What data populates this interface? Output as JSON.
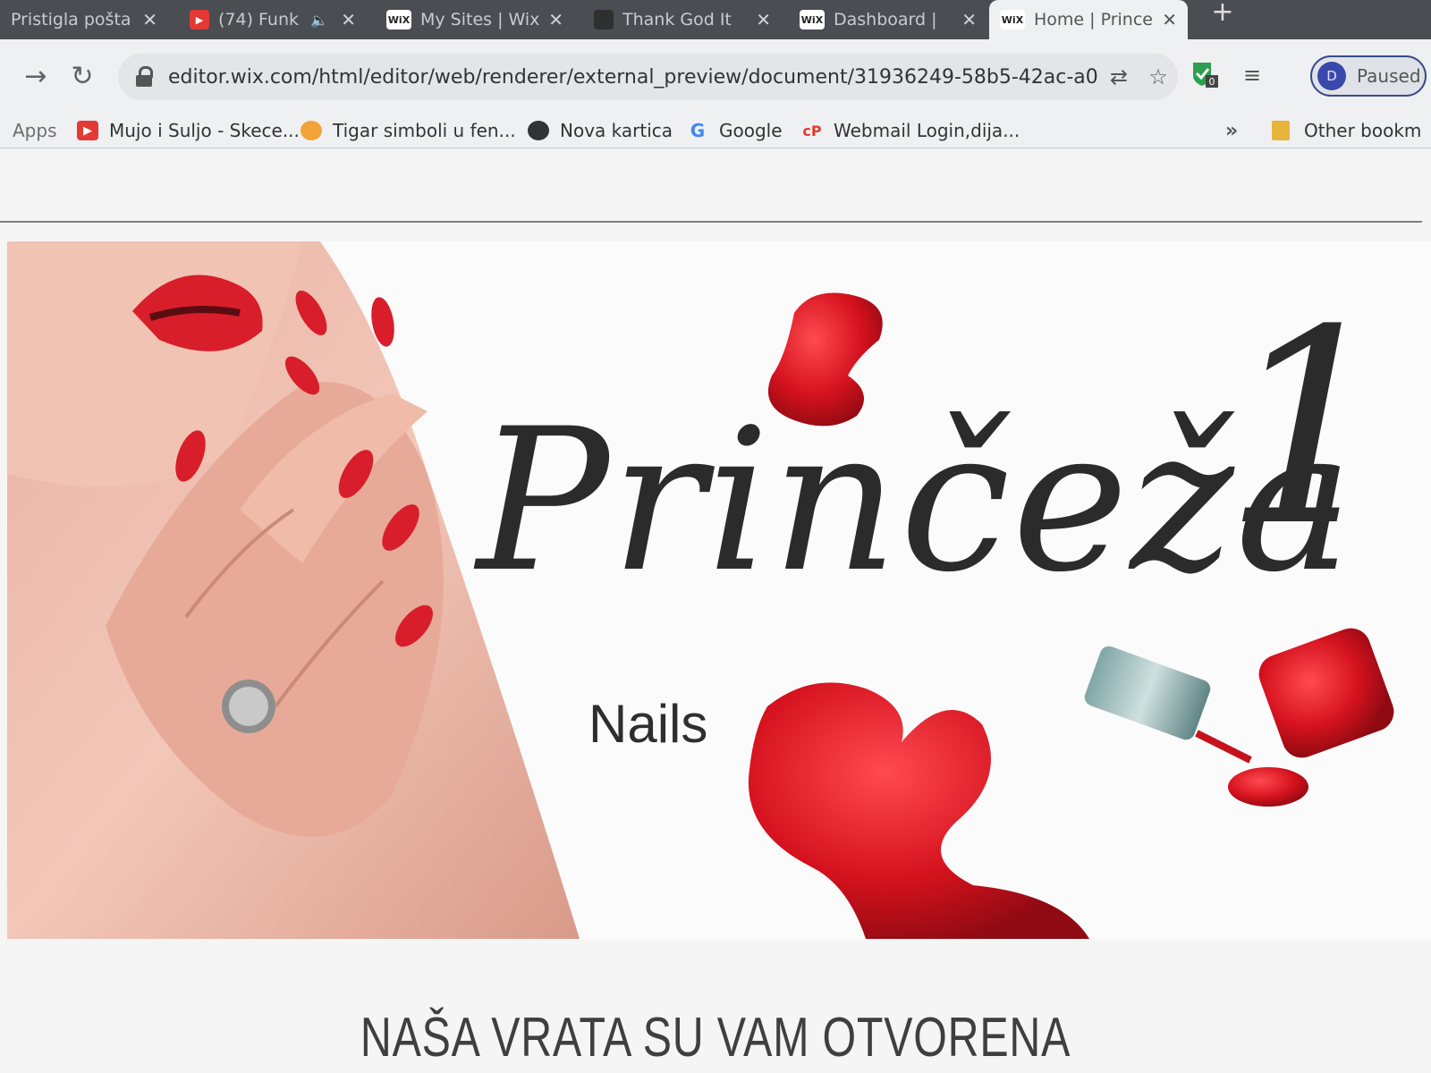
{
  "browser": {
    "tabs": [
      {
        "title": "Pristigla pošta",
        "favicon": "mail-icon",
        "active": false
      },
      {
        "title": "(74) Funk",
        "favicon": "youtube-icon",
        "active": false,
        "muted_audio_icon": "speaker-icon"
      },
      {
        "title": "My Sites | Wix",
        "favicon": "wix-icon",
        "active": false
      },
      {
        "title": "Thank God It",
        "favicon": "page-icon",
        "active": false
      },
      {
        "title": "Dashboard |",
        "favicon": "wix-icon",
        "active": false
      },
      {
        "title": "Home | Prince",
        "favicon": "wix-icon",
        "active": true
      }
    ],
    "new_tab_label": "+",
    "url": "editor.wix.com/html/editor/web/renderer/external_preview/document/31936249-58b5-42ac-a0...",
    "profile": {
      "initial": "D",
      "label": "Paused"
    },
    "extension_badge": "0",
    "bookmarks": {
      "apps_label": "Apps",
      "items": [
        {
          "label": "Mujo i Suljo - Skece...",
          "icon": "youtube-icon"
        },
        {
          "label": "Tigar simboli u fen...",
          "icon": "page-icon"
        },
        {
          "label": "Nova kartica",
          "icon": "globe-icon"
        },
        {
          "label": "Google",
          "icon": "google-icon"
        },
        {
          "label": "Webmail Login,dija...",
          "icon": "cpanel-icon"
        }
      ],
      "more_label": "»",
      "other_label": "Other bookm"
    }
  },
  "page": {
    "logo": {
      "script": "Prinčeža",
      "number": "1",
      "subtitle": "Nails"
    },
    "heading": "NAŠA VRATA SU VAM OTVORENA"
  },
  "colors": {
    "accent_red": "#d8222b",
    "tab_strip": "#4a4d52",
    "toolbar": "#eef0f2",
    "text_dark": "#2b2b2b"
  }
}
